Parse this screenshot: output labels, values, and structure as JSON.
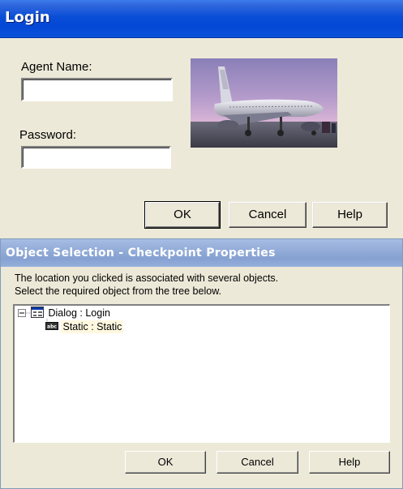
{
  "login": {
    "title": "Login",
    "agent_name_label": "Agent Name:",
    "agent_name_value": "",
    "password_label": "Password:",
    "password_value": "",
    "ok_label": "OK",
    "cancel_label": "Cancel",
    "help_label": "Help",
    "photo_icon": "airplane-photo"
  },
  "object_selection": {
    "title": "Object Selection - Checkpoint Properties",
    "message_line1": "The location you clicked is associated with several objects.",
    "message_line2": "Select the required object from the tree below.",
    "tree": [
      {
        "label": "Dialog : Login",
        "icon": "dialog-icon",
        "expanded": true
      },
      {
        "label": "Static : Static",
        "icon": "static-text-icon",
        "selected": true
      }
    ],
    "ok_label": "OK",
    "cancel_label": "Cancel",
    "help_label": "Help"
  }
}
